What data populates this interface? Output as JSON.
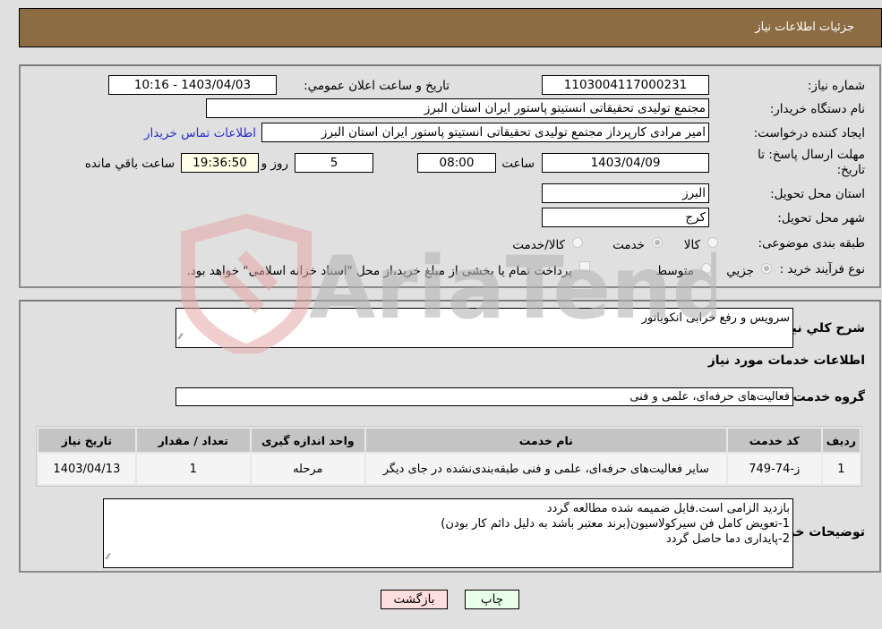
{
  "header": {
    "title": "جزئیات اطلاعات نیاز"
  },
  "details": {
    "need_number": {
      "label": "شماره نیاز:",
      "value": "1103004117000231"
    },
    "announce_datetime": {
      "label": "تاریخ و ساعت اعلان عمومي:",
      "value": "1403/04/03 - 10:16"
    },
    "buyer_org": {
      "label": "نام دستگاه خريدار:",
      "value": "مجتمع تولیدی تحقیقاتی انستیتو پاستور ایران استان البرز"
    },
    "requester": {
      "label": "ايجاد کننده درخواست:",
      "value": "امیر مرادی کارپرداز مجتمع تولیدی تحقیقاتی انستیتو پاستور ایران استان البرز"
    },
    "buyer_contact_link": "اطلاعات تماس خريدار",
    "deadline": {
      "label": "مهلت ارسال پاسخ: تا تاريخ:",
      "date": "1403/04/09",
      "time_label": "ساعت",
      "time": "08:00",
      "days": "5",
      "days_label": "روز و",
      "remaining": "19:36:50",
      "remaining_label": "ساعت باقي مانده"
    },
    "delivery_province": {
      "label": "استان محل تحویل:",
      "value": "البرز"
    },
    "delivery_city": {
      "label": "شهر محل تحویل:",
      "value": "کرج"
    },
    "category": {
      "label": "طبقه بندی موضوعی:",
      "options": [
        "کالا",
        "خدمت",
        "کالا/خدمت"
      ],
      "selected": "خدمت"
    },
    "purchase_process": {
      "label": "نوع فرآيند خريد :",
      "options": [
        "جزيي",
        "متوسط"
      ],
      "selected": "جزيي",
      "treasury_note": "پرداخت تمام يا بخشی از مبلغ خريد،از محل \"اسناد خزانه اسلامی\" خواهد بود."
    }
  },
  "summary": {
    "label": "شرح کلي نياز:",
    "value": "سرویس و رفع خرابی انکوباتور"
  },
  "services_section": {
    "title": "اطلاعات خدمات مورد نياز",
    "group_label": "گروه خدمت:",
    "group_value": "فعالیت‌های حرفه‌ای، علمی و فنی"
  },
  "table": {
    "headers": [
      "رديف",
      "کد خدمت",
      "نام خدمت",
      "واحد اندازه گيری",
      "تعداد / مقدار",
      "تاريخ نياز"
    ],
    "rows": [
      {
        "index": "1",
        "code": "ز-74-749",
        "name": "سایر فعالیت‌های حرفه‌ای، علمی و فنی طبقه‌بندی‌نشده در جای دیگر",
        "unit": "مرحله",
        "quantity": "1",
        "date": "1403/04/13"
      }
    ]
  },
  "buyer_notes": {
    "label": "توضيحات خريدار:",
    "lines": [
      "بازدید الزامی است.فایل ضمیمه شده مطالعه گردد",
      "1-تعویض کامل فن سیرکولاسیون(برند معتبر باشد به دلیل دائم کار بودن)",
      "2-پایداری دما حاصل گردد"
    ]
  },
  "buttons": {
    "print": "چاپ",
    "back": "بازگشت"
  },
  "watermark": {
    "text": "AriaTender.neT",
    "colors": {
      "shield": "#e4a7a7",
      "text": "#b5b5b5"
    }
  }
}
